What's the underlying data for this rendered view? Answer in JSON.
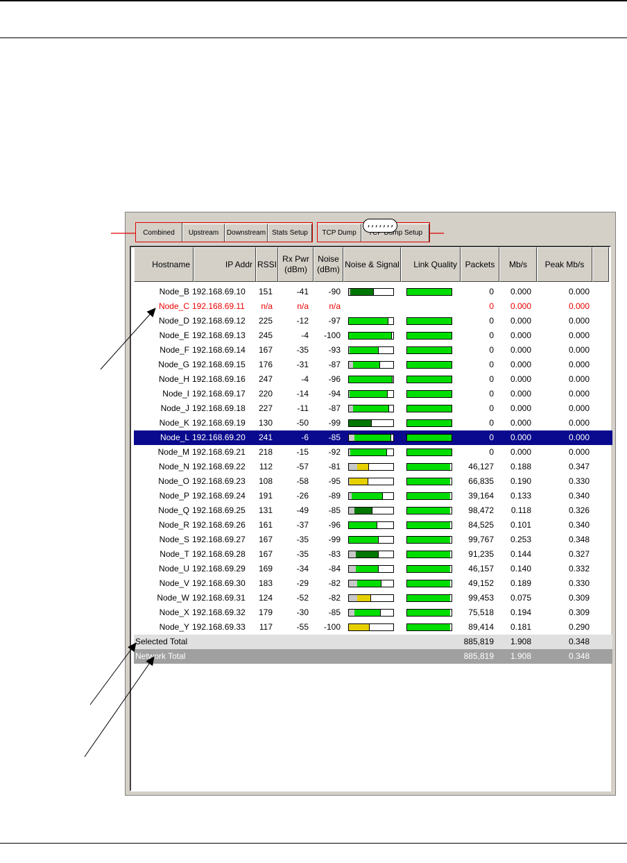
{
  "tabs": [
    {
      "label": "Combined",
      "active": true
    },
    {
      "label": "Upstream",
      "active": false
    },
    {
      "label": "Downstream",
      "active": false
    },
    {
      "label": "Stats Setup",
      "active": false
    },
    {
      "label": "TCP Dump",
      "active": false
    },
    {
      "label": "TCP Dump Setup",
      "active": false
    }
  ],
  "grip_label": ",,,,,,,",
  "columns": [
    {
      "key": "host",
      "label": "Hostname"
    },
    {
      "key": "ip",
      "label": "IP Addr"
    },
    {
      "key": "rssi",
      "label": "RSSI"
    },
    {
      "key": "rxpwr",
      "label": "Rx Pwr (dBm)"
    },
    {
      "key": "noise",
      "label": "Noise (dBm)"
    },
    {
      "key": "ns",
      "label": "Noise & Signal"
    },
    {
      "key": "lq",
      "label": "Link Quality"
    },
    {
      "key": "packets",
      "label": "Packets"
    },
    {
      "key": "mbs",
      "label": "Mb/s"
    },
    {
      "key": "peak",
      "label": "Peak Mb/s"
    }
  ],
  "colors": {
    "green": "#00dd00",
    "dark_green": "#007700",
    "yellow": "#e6d000",
    "gray": "#c8c8c8",
    "error_text": "#ee0000",
    "selected_row": "#0a0a8e"
  },
  "rows": [
    {
      "host": "Node_B",
      "ip": "192.168.69.10",
      "rssi": "151",
      "rxpwr": "-41",
      "noise": "-90",
      "packets": "0",
      "mbs": "0.000",
      "peak": "0.000",
      "noise_level": 0.03,
      "signal_level": 0.55,
      "signal_color": "dark_green",
      "link_quality": 1.0
    },
    {
      "host": "Node_C",
      "ip": "192.168.69.11",
      "rssi": "n/a",
      "rxpwr": "n/a",
      "noise": "n/a",
      "packets": "0",
      "mbs": "0.000",
      "peak": "0.000",
      "state": "error"
    },
    {
      "host": "Node_D",
      "ip": "192.168.69.12",
      "rssi": "225",
      "rxpwr": "-12",
      "noise": "-97",
      "packets": "0",
      "mbs": "0.000",
      "peak": "0.000",
      "noise_level": 0.0,
      "signal_level": 0.88,
      "signal_color": "green",
      "link_quality": 1.0
    },
    {
      "host": "Node_E",
      "ip": "192.168.69.13",
      "rssi": "245",
      "rxpwr": "-4",
      "noise": "-100",
      "packets": "0",
      "mbs": "0.000",
      "peak": "0.000",
      "noise_level": 0.0,
      "signal_level": 0.96,
      "signal_color": "green",
      "link_quality": 1.0
    },
    {
      "host": "Node_F",
      "ip": "192.168.69.14",
      "rssi": "167",
      "rxpwr": "-35",
      "noise": "-93",
      "packets": "0",
      "mbs": "0.000",
      "peak": "0.000",
      "noise_level": 0.02,
      "signal_level": 0.65,
      "signal_color": "green",
      "link_quality": 1.0
    },
    {
      "host": "Node_G",
      "ip": "192.168.69.15",
      "rssi": "176",
      "rxpwr": "-31",
      "noise": "-87",
      "packets": "0",
      "mbs": "0.000",
      "peak": "0.000",
      "noise_level": 0.1,
      "signal_level": 0.69,
      "signal_color": "green",
      "link_quality": 1.0
    },
    {
      "host": "Node_H",
      "ip": "192.168.69.16",
      "rssi": "247",
      "rxpwr": "-4",
      "noise": "-96",
      "packets": "0",
      "mbs": "0.000",
      "peak": "0.000",
      "noise_level": 0.0,
      "signal_level": 0.97,
      "signal_color": "green",
      "link_quality": 1.0
    },
    {
      "host": "Node_I",
      "ip": "192.168.69.17",
      "rssi": "220",
      "rxpwr": "-14",
      "noise": "-94",
      "packets": "0",
      "mbs": "0.000",
      "peak": "0.000",
      "noise_level": 0.02,
      "signal_level": 0.86,
      "signal_color": "green",
      "link_quality": 1.0
    },
    {
      "host": "Node_J",
      "ip": "192.168.69.18",
      "rssi": "227",
      "rxpwr": "-11",
      "noise": "-87",
      "packets": "0",
      "mbs": "0.000",
      "peak": "0.000",
      "noise_level": 0.1,
      "signal_level": 0.89,
      "signal_color": "green",
      "link_quality": 1.0
    },
    {
      "host": "Node_K",
      "ip": "192.168.69.19",
      "rssi": "130",
      "rxpwr": "-50",
      "noise": "-99",
      "packets": "0",
      "mbs": "0.000",
      "peak": "0.000",
      "noise_level": 0.0,
      "signal_level": 0.5,
      "signal_color": "dark_green",
      "link_quality": 1.0
    },
    {
      "host": "Node_L",
      "ip": "192.168.69.20",
      "rssi": "241",
      "rxpwr": "-6",
      "noise": "-85",
      "packets": "0",
      "mbs": "0.000",
      "peak": "0.000",
      "noise_level": 0.13,
      "signal_level": 0.94,
      "signal_color": "green",
      "link_quality": 1.0,
      "state": "selected"
    },
    {
      "host": "Node_M",
      "ip": "192.168.69.21",
      "rssi": "218",
      "rxpwr": "-15",
      "noise": "-92",
      "packets": "0",
      "mbs": "0.000",
      "peak": "0.000",
      "noise_level": 0.03,
      "signal_level": 0.85,
      "signal_color": "green",
      "link_quality": 1.0
    },
    {
      "host": "Node_N",
      "ip": "192.168.69.22",
      "rssi": "112",
      "rxpwr": "-57",
      "noise": "-81",
      "packets": "46,127",
      "mbs": "0.188",
      "peak": "0.347",
      "noise_level": 0.19,
      "signal_level": 0.44,
      "signal_color": "yellow",
      "link_quality": 0.97
    },
    {
      "host": "Node_O",
      "ip": "192.168.69.23",
      "rssi": "108",
      "rxpwr": "-58",
      "noise": "-95",
      "packets": "66,835",
      "mbs": "0.190",
      "peak": "0.330",
      "noise_level": 0.02,
      "signal_level": 0.42,
      "signal_color": "yellow",
      "link_quality": 0.97
    },
    {
      "host": "Node_P",
      "ip": "192.168.69.24",
      "rssi": "191",
      "rxpwr": "-26",
      "noise": "-89",
      "packets": "39,164",
      "mbs": "0.133",
      "peak": "0.340",
      "noise_level": 0.07,
      "signal_level": 0.75,
      "signal_color": "green",
      "link_quality": 0.97
    },
    {
      "host": "Node_Q",
      "ip": "192.168.69.25",
      "rssi": "131",
      "rxpwr": "-49",
      "noise": "-85",
      "packets": "98,472",
      "mbs": "0.118",
      "peak": "0.326",
      "noise_level": 0.13,
      "signal_level": 0.51,
      "signal_color": "dark_green",
      "link_quality": 0.97
    },
    {
      "host": "Node_R",
      "ip": "192.168.69.26",
      "rssi": "161",
      "rxpwr": "-37",
      "noise": "-96",
      "packets": "84,525",
      "mbs": "0.101",
      "peak": "0.340",
      "noise_level": 0.0,
      "signal_level": 0.63,
      "signal_color": "green",
      "link_quality": 0.97
    },
    {
      "host": "Node_S",
      "ip": "192.168.69.27",
      "rssi": "167",
      "rxpwr": "-35",
      "noise": "-99",
      "packets": "99,767",
      "mbs": "0.253",
      "peak": "0.348",
      "noise_level": 0.0,
      "signal_level": 0.65,
      "signal_color": "green",
      "link_quality": 0.97
    },
    {
      "host": "Node_T",
      "ip": "192.168.69.28",
      "rssi": "167",
      "rxpwr": "-35",
      "noise": "-83",
      "packets": "91,235",
      "mbs": "0.144",
      "peak": "0.327",
      "noise_level": 0.16,
      "signal_level": 0.65,
      "signal_color": "dark_green",
      "link_quality": 0.97
    },
    {
      "host": "Node_U",
      "ip": "192.168.69.29",
      "rssi": "169",
      "rxpwr": "-34",
      "noise": "-84",
      "packets": "46,157",
      "mbs": "0.140",
      "peak": "0.332",
      "noise_level": 0.15,
      "signal_level": 0.66,
      "signal_color": "green",
      "link_quality": 0.97
    },
    {
      "host": "Node_V",
      "ip": "192.168.69.30",
      "rssi": "183",
      "rxpwr": "-29",
      "noise": "-82",
      "packets": "49,152",
      "mbs": "0.189",
      "peak": "0.330",
      "noise_level": 0.18,
      "signal_level": 0.72,
      "signal_color": "green",
      "link_quality": 0.97
    },
    {
      "host": "Node_W",
      "ip": "192.168.69.31",
      "rssi": "124",
      "rxpwr": "-52",
      "noise": "-82",
      "packets": "99,453",
      "mbs": "0.075",
      "peak": "0.309",
      "noise_level": 0.18,
      "signal_level": 0.48,
      "signal_color": "yellow",
      "link_quality": 0.97
    },
    {
      "host": "Node_X",
      "ip": "192.168.69.32",
      "rssi": "179",
      "rxpwr": "-30",
      "noise": "-85",
      "packets": "75,518",
      "mbs": "0.194",
      "peak": "0.309",
      "noise_level": 0.13,
      "signal_level": 0.7,
      "signal_color": "green",
      "link_quality": 0.97
    },
    {
      "host": "Node_Y",
      "ip": "192.168.69.33",
      "rssi": "117",
      "rxpwr": "-55",
      "noise": "-100",
      "packets": "89,414",
      "mbs": "0.181",
      "peak": "0.290",
      "noise_level": 0.0,
      "signal_level": 0.46,
      "signal_color": "yellow",
      "link_quality": 0.97
    }
  ],
  "totals": [
    {
      "label": "Selected Total",
      "packets": "885,819",
      "mbs": "1.908",
      "peak": "0.348"
    },
    {
      "label": "Network Total",
      "packets": "885,819",
      "mbs": "1.908",
      "peak": "0.348"
    }
  ]
}
